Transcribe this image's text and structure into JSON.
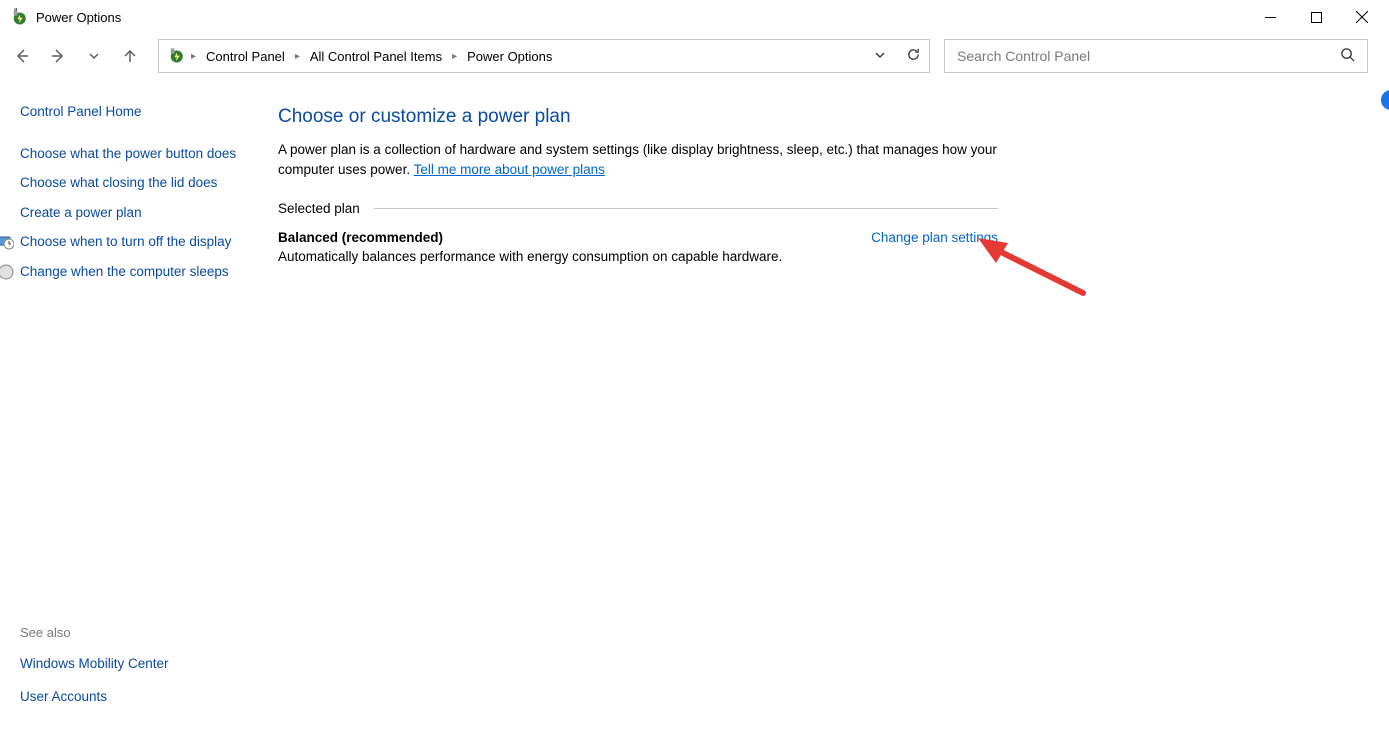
{
  "window": {
    "title": "Power Options"
  },
  "breadcrumb": {
    "items": [
      "Control Panel",
      "All Control Panel Items",
      "Power Options"
    ]
  },
  "search": {
    "placeholder": "Search Control Panel"
  },
  "sidebar": {
    "home": "Control Panel Home",
    "links": [
      "Choose what the power button does",
      "Choose what closing the lid does",
      "Create a power plan",
      "Choose when to turn off the display",
      "Change when the computer sleeps"
    ],
    "see_also_label": "See also",
    "see_also": [
      "Windows Mobility Center",
      "User Accounts"
    ]
  },
  "main": {
    "heading": "Choose or customize a power plan",
    "description_prefix": "A power plan is a collection of hardware and system settings (like display brightness, sleep, etc.) that manages how your computer uses power. ",
    "description_link": "Tell me more about power plans",
    "section_label": "Selected plan",
    "plan": {
      "name": "Balanced (recommended)",
      "description": "Automatically balances performance with energy consumption on capable hardware.",
      "change_link": "Change plan settings"
    }
  }
}
